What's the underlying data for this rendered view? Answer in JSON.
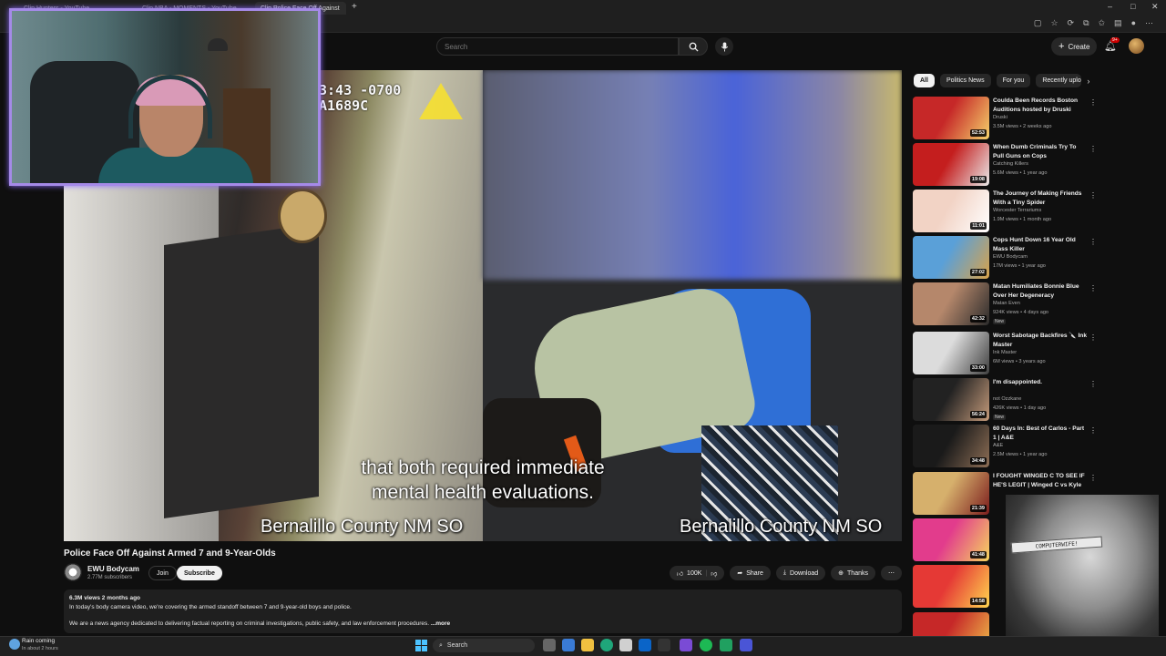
{
  "browser": {
    "tabs": [
      {
        "label": "Clip Hunters - YouTube",
        "active": false
      },
      {
        "label": "Clip NBA - MOMENTS - YouTube",
        "active": false
      },
      {
        "label": "Clip Police Face Off Against",
        "active": true
      }
    ],
    "new_tab": "+",
    "win_controls": [
      "–",
      "□",
      "✕"
    ]
  },
  "header": {
    "search_placeholder": "Search",
    "create_label": "Create",
    "notif_badge": "9+"
  },
  "video": {
    "timestamp": "3:43 -0700\nA1689C",
    "caption_line1": "that both required immediate",
    "caption_line2": "mental health evaluations.",
    "agency_left": "Bernalillo County NM SO",
    "agency_right": "Bernalillo County NM SO",
    "title": "Police Face Off Against Armed 7 and 9-Year-Olds"
  },
  "channel": {
    "name": "EWU Bodycam",
    "subs": "2.77M subscribers",
    "join": "Join",
    "subscribe": "Subscribe"
  },
  "actions": {
    "likes": "100K",
    "share": "Share",
    "download": "Download",
    "thanks": "Thanks"
  },
  "description": {
    "stats": "6.3M views  2 months ago",
    "line1": "In today's body camera video, we're covering the armed standoff between 7 and 9-year-old boys and police.",
    "line2": "We are a news agency dedicated to delivering factual reporting on criminal investigations, public safety, and law enforcement procedures.",
    "more": "...more"
  },
  "chips": [
    "All",
    "Politics News",
    "For you",
    "Recently uploaded"
  ],
  "recommendations": [
    {
      "title": "Coulda Been Records Boston Auditions hosted by Druski",
      "channel": "Druski",
      "meta": "3.5M views • 2 weeks ago",
      "duration": "52:53",
      "new": "",
      "c1": "#c62828",
      "c2": "#f5d26b"
    },
    {
      "title": "When Dumb Criminals Try To Pull Guns on Cops",
      "channel": "Catching Killers",
      "meta": "5.6M views • 1 year ago",
      "duration": "19:08",
      "new": "",
      "c1": "#c41e1e",
      "c2": "#e9e9e9"
    },
    {
      "title": "The Journey of Making Friends With a Tiny Spider",
      "channel": "Worcester Terrariums",
      "meta": "1.9M views • 1 month ago",
      "duration": "11:01",
      "new": "",
      "c1": "#f2d3c5",
      "c2": "#ffffff"
    },
    {
      "title": "Cops Hunt Down 16 Year Old Mass Killer",
      "channel": "EWU Bodycam",
      "meta": "17M views • 1 year ago",
      "duration": "27:02",
      "new": "",
      "c1": "#5aa0d8",
      "c2": "#d9a24a"
    },
    {
      "title": "Matan Humiliates Bonnie Blue Over Her Degeneracy",
      "channel": "Matan Even",
      "meta": "924K views • 4 days ago",
      "duration": "42:32",
      "new": "New",
      "c1": "#b5876b",
      "c2": "#2b2b2b"
    },
    {
      "title": "Worst Sabotage Backfires 🔪 Ink Master",
      "channel": "Ink Master",
      "meta": "6M views • 3 years ago",
      "duration": "33:00",
      "new": "",
      "c1": "#dcdcdc",
      "c2": "#404040"
    },
    {
      "title": "I'm disappointed.",
      "channel": "not Ozzkane",
      "meta": "426K views • 1 day ago",
      "duration": "56:24",
      "new": "New",
      "c1": "#222222",
      "c2": "#c49a7a"
    },
    {
      "title": "60 Days In: Best of Carlos - Part 1 | A&E",
      "channel": "A&E",
      "meta": "2.5M views • 1 year ago",
      "duration": "34:48",
      "new": "",
      "c1": "#1a1a1a",
      "c2": "#8d6e55"
    },
    {
      "title": "I FOUGHT WINGED C TO SEE IF HE'S LEGIT | Winged C vs Kyle",
      "channel": "",
      "meta": "",
      "duration": "21:39",
      "new": "",
      "c1": "#d6b06c",
      "c2": "#7b1d1d"
    },
    {
      "title": "",
      "channel": "",
      "meta": "",
      "duration": "41:48",
      "new": "",
      "c1": "#e23c8c",
      "c2": "#f5d55e"
    },
    {
      "title": "",
      "channel": "",
      "meta": "",
      "duration": "14:58",
      "new": "",
      "c1": "#e53935",
      "c2": "#ffd54f"
    },
    {
      "title": "",
      "channel": "",
      "meta": "",
      "duration": "",
      "new": "",
      "c1": "#c62828",
      "c2": "#f0c14b"
    }
  ],
  "overlay": {
    "sketch_label": "COMPUTERWIFE!"
  },
  "taskbar": {
    "weather_title": "Rain coming",
    "weather_sub": "In about 2 hours",
    "search": "Search"
  }
}
